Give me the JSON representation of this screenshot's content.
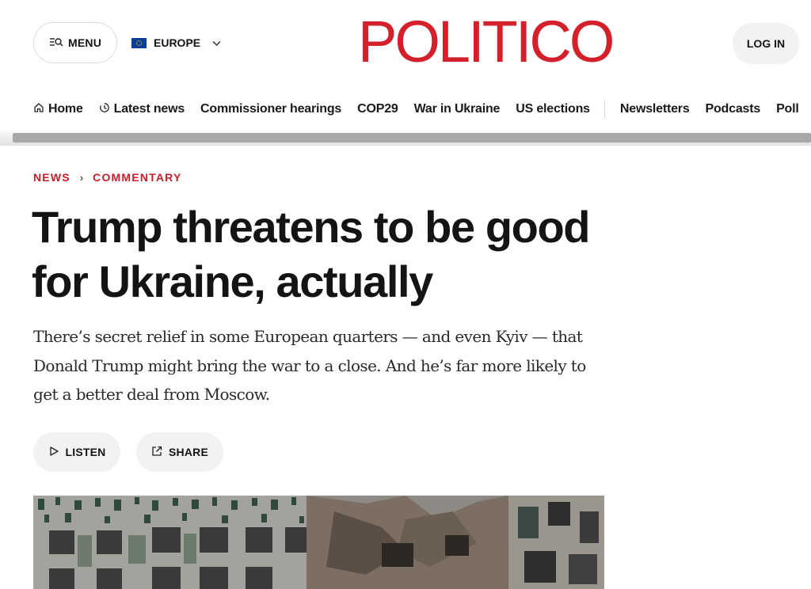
{
  "header": {
    "menu_label": "MENU",
    "edition_label": "EUROPE",
    "logo_text": "POLITICO",
    "login_label": "LOG IN",
    "brand_color": "#d3202b"
  },
  "nav": {
    "items": [
      {
        "label": "Home",
        "icon": "home-icon"
      },
      {
        "label": "Latest news",
        "icon": "clock-icon"
      },
      {
        "label": "Commissioner hearings"
      },
      {
        "label": "COP29"
      },
      {
        "label": "War in Ukraine"
      },
      {
        "label": "US elections"
      },
      {
        "label": "Newsletters"
      },
      {
        "label": "Podcasts"
      },
      {
        "label": "Poll"
      }
    ]
  },
  "breadcrumb": {
    "section": "NEWS",
    "separator": "›",
    "subsection": "COMMENTARY"
  },
  "article": {
    "headline": "Trump threatens to be good for Ukraine, actually",
    "dek": "There’s secret relief in some European quarters — and even Kyiv — that Donald Trump might bring the war to a close. And he’s far more likely to get a better deal from Moscow.",
    "listen_label": "LISTEN",
    "share_label": "SHARE",
    "hero_image": "bombed-apartment-building-image"
  }
}
